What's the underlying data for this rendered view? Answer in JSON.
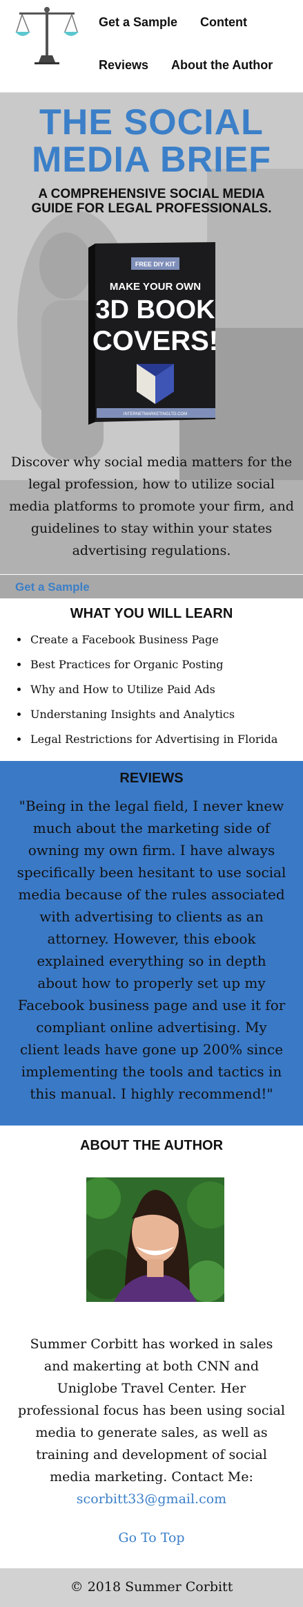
{
  "nav": {
    "links": [
      "Get a Sample",
      "Content",
      "Reviews",
      "About the Author"
    ]
  },
  "hero": {
    "title": "THE SOCIAL MEDIA BRIEF",
    "subtitle": "A COMPREHENSIVE SOCIAL MEDIA GUIDE FOR LEGAL PROFESSIONALS.",
    "book": {
      "badge": "FREE DIY KIT",
      "line1": "MAKE YOUR OWN",
      "line2": "3D BOOK",
      "line3": "COVERS!",
      "url": "INTERNETMARKETINGLTD.COM"
    },
    "description": "Discover why social media matters for the legal profession, how to utilize social media platforms to promote your firm, and guidelines to stay within your states advertising regulations.",
    "sample_link": "Get a Sample"
  },
  "learn": {
    "title": "WHAT YOU WILL LEARN",
    "items": [
      "Create a Facebook Business Page",
      "Best Practices for Organic Posting",
      "Why and How to Utilize Paid Ads",
      "Understaning Insights and Analytics",
      "Legal Restrictions for Advertising in Florida"
    ]
  },
  "reviews": {
    "title": "REVIEWS",
    "text": "\"Being in the legal field, I never knew much about the marketing side of owning my own firm. I have always specifically been hesitant to use social media because of the rules associated with advertising to clients as an attorney. However, this ebook explained everything so in depth about how to properly set up my Facebook business page and use it for compliant online advertising. My client leads have gone up 200% since implementing the tools and tactics in this manual. I highly recommend!\""
  },
  "author": {
    "title": "ABOUT THE AUTHOR",
    "bio": "Summer Corbitt has worked in sales and makerting at both CNN and Uniglobe Travel Center. Her professional focus has been using social media to generate sales, as well as training and development of social media marketing. Contact Me:",
    "email": "scorbitt33@gmail.com",
    "top_link": "Go To Top"
  },
  "footer": {
    "text": "© 2018 Summer Corbitt"
  },
  "colors": {
    "accent": "#3b7fc8",
    "reviews_bg": "#3a79c6",
    "footer_bg": "#d2d2d2",
    "logo_teal": "#5cc7cf"
  },
  "icons": {
    "logo": "scales-of-justice-icon"
  }
}
